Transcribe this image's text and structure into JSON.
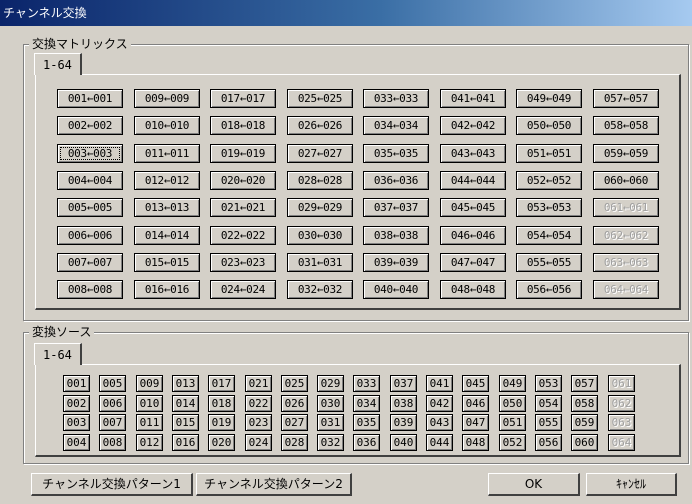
{
  "window": {
    "title": "チャンネル交換"
  },
  "matrix": {
    "label": "交換マトリックス",
    "tab": "1-64",
    "buttons": [
      "001←001",
      "002←002",
      "003←003",
      "004←004",
      "005←005",
      "006←006",
      "007←007",
      "008←008",
      "009←009",
      "010←010",
      "011←011",
      "012←012",
      "013←013",
      "014←014",
      "015←015",
      "016←016",
      "017←017",
      "018←018",
      "019←019",
      "020←020",
      "021←021",
      "022←022",
      "023←023",
      "024←024",
      "025←025",
      "026←026",
      "027←027",
      "028←028",
      "029←029",
      "030←030",
      "031←031",
      "032←032",
      "033←033",
      "034←034",
      "035←035",
      "036←036",
      "037←037",
      "038←038",
      "039←039",
      "040←040",
      "041←041",
      "042←042",
      "043←043",
      "044←044",
      "045←045",
      "046←046",
      "047←047",
      "048←048",
      "049←049",
      "050←050",
      "051←051",
      "052←052",
      "053←053",
      "054←054",
      "055←055",
      "056←056",
      "057←057",
      "058←058",
      "059←059",
      "060←060",
      "061←061",
      "062←062",
      "063←063",
      "064←064"
    ],
    "focused": "003←003",
    "disabled": [
      "061←061",
      "062←062",
      "063←063",
      "064←064"
    ]
  },
  "source": {
    "label": "変換ソース",
    "tab": "1-64",
    "buttons": [
      "001",
      "002",
      "003",
      "004",
      "005",
      "006",
      "007",
      "008",
      "009",
      "010",
      "011",
      "012",
      "013",
      "014",
      "015",
      "016",
      "017",
      "018",
      "019",
      "020",
      "021",
      "022",
      "023",
      "024",
      "025",
      "026",
      "027",
      "028",
      "029",
      "030",
      "031",
      "032",
      "033",
      "034",
      "035",
      "036",
      "037",
      "038",
      "039",
      "040",
      "041",
      "042",
      "043",
      "044",
      "045",
      "046",
      "047",
      "048",
      "049",
      "050",
      "051",
      "052",
      "053",
      "054",
      "055",
      "056",
      "057",
      "058",
      "059",
      "060",
      "061",
      "062",
      "063",
      "064"
    ],
    "disabled": [
      "061",
      "062",
      "063",
      "064"
    ]
  },
  "footer": {
    "pattern1": "チャンネル交換パターン1",
    "pattern2": "チャンネル交換パターン2",
    "ok": "OK",
    "cancel": "ｷｬﾝｾﾙ"
  }
}
